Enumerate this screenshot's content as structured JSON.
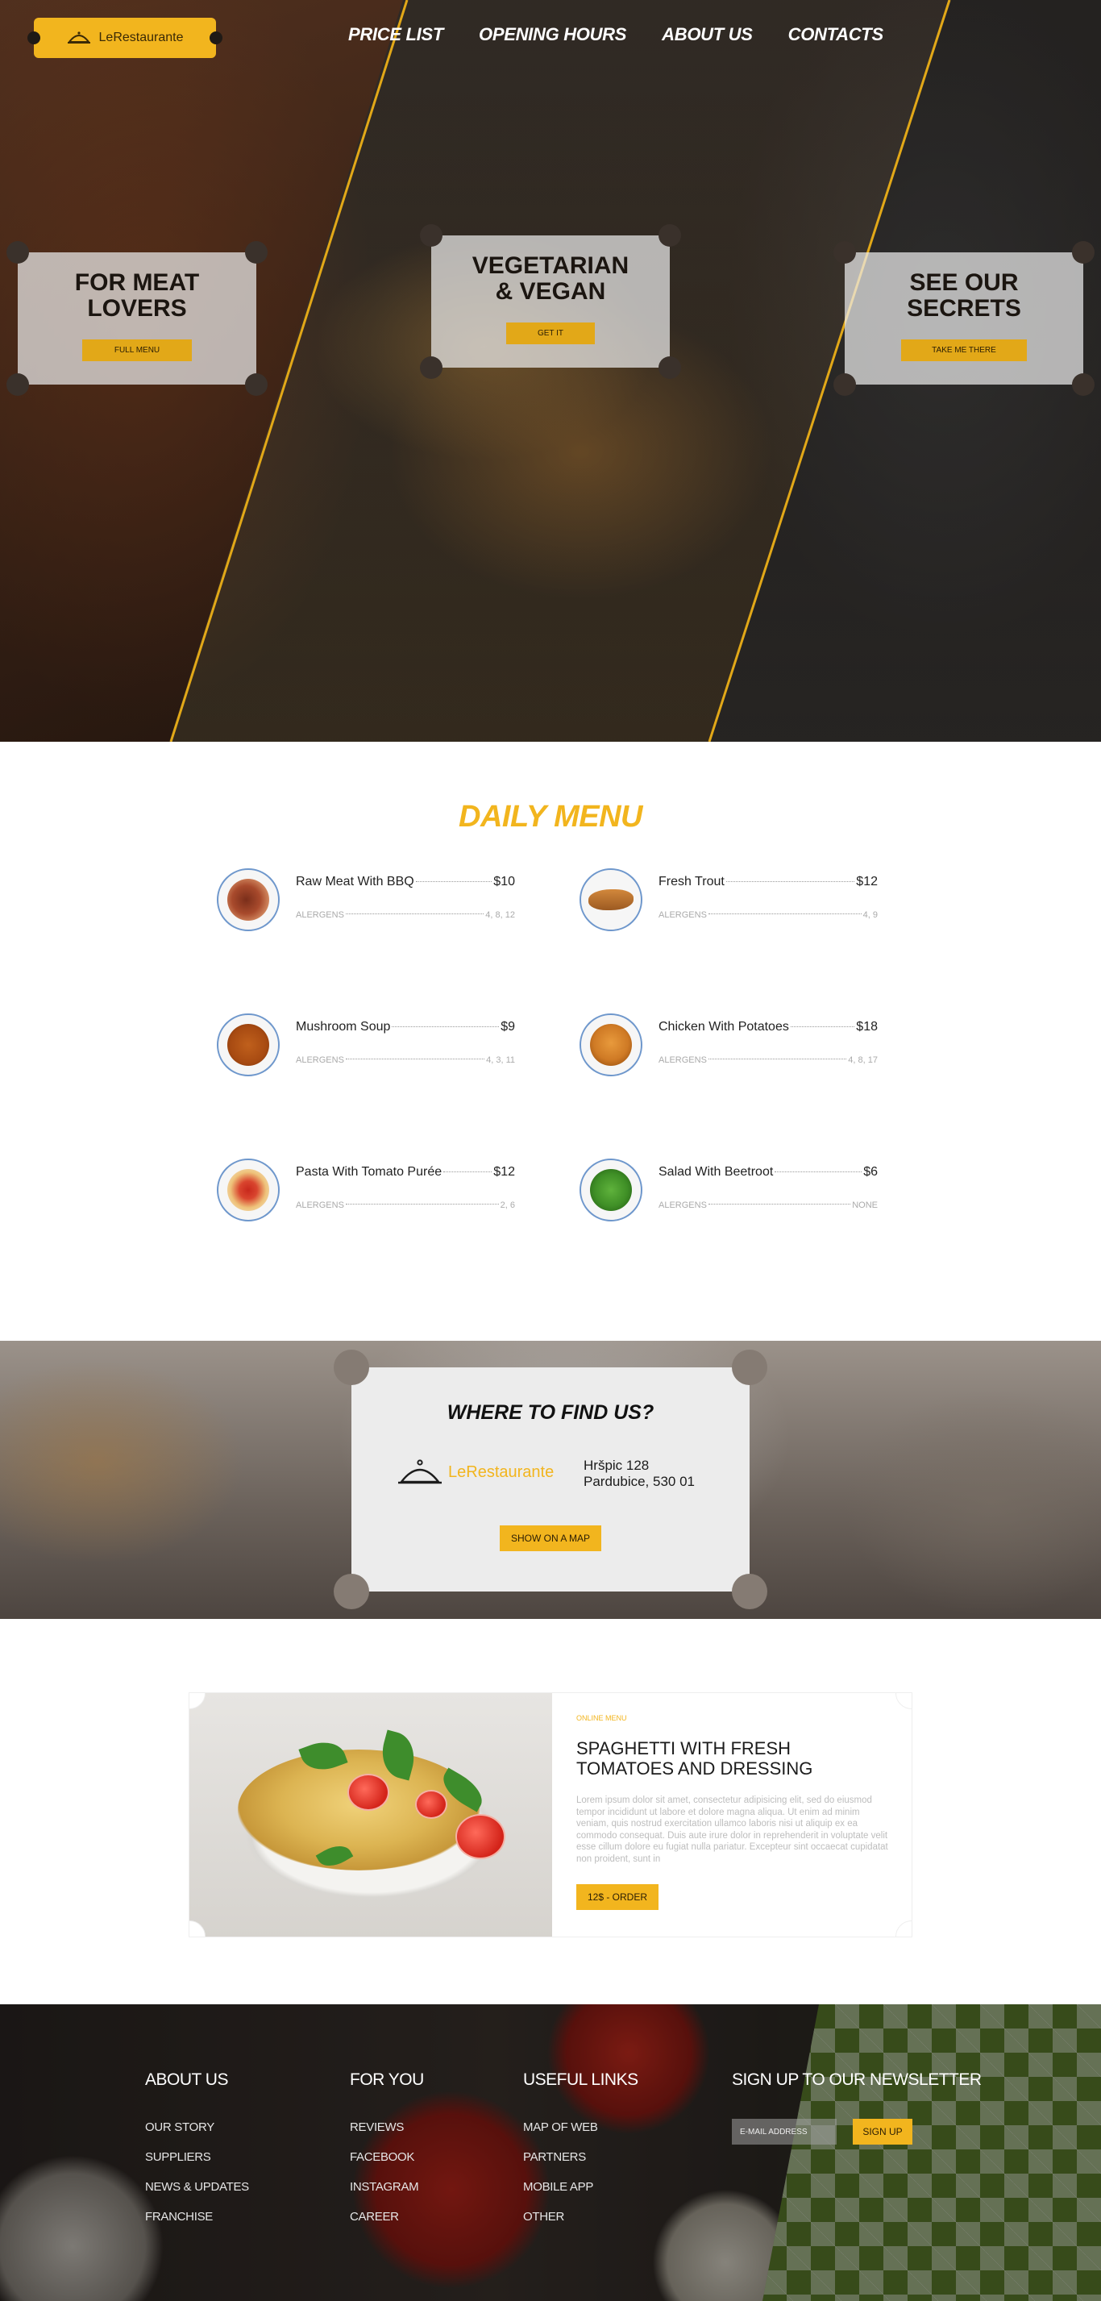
{
  "brand": {
    "name": "LeRestaurante"
  },
  "nav": {
    "items": [
      {
        "label": "Price List"
      },
      {
        "label": "Opening Hours"
      },
      {
        "label": "About Us"
      },
      {
        "label": "Contacts"
      }
    ]
  },
  "hero": {
    "panels": [
      {
        "title": "For Meat Lovers",
        "button": "Full Menu"
      },
      {
        "title": "Vegetarian & Vegan",
        "button": "Get It"
      },
      {
        "title": "See Our Secrets",
        "button": "Take Me There"
      }
    ]
  },
  "daily_menu": {
    "title": "Daily Menu",
    "allergens_label": "Alergens",
    "items": [
      {
        "name": "Raw Meat With BBQ",
        "price": "$10",
        "allergens": "4, 8, 12",
        "icon": "bbq-meat-icon"
      },
      {
        "name": "Fresh Trout",
        "price": "$12",
        "allergens": "4, 9",
        "icon": "fish-icon"
      },
      {
        "name": "Mushroom Soup",
        "price": "$9",
        "allergens": "4, 3, 11",
        "icon": "soup-icon"
      },
      {
        "name": "Chicken With Potatoes",
        "price": "$18",
        "allergens": "4, 8, 17",
        "icon": "chicken-icon"
      },
      {
        "name": "Pasta With Tomato Purée",
        "price": "$12",
        "allergens": "2, 6",
        "icon": "pasta-icon"
      },
      {
        "name": "Salad With Beetroot",
        "price": "$6",
        "allergens": "None",
        "icon": "salad-icon"
      }
    ]
  },
  "location": {
    "title": "Where To Find Us?",
    "brand": "LeRestaurante",
    "address_line1": "Hršpic 128",
    "address_line2": "Pardubice, 530 01",
    "button": "Show On A Map"
  },
  "feature": {
    "kicker": "Online Menu",
    "title": "Spaghetti With Fresh Tomatoes And Dressing",
    "description": "Lorem ipsum dolor sit amet, consectetur adipisicing elit, sed do eiusmod tempor incididunt ut labore et dolore magna aliqua. Ut enim ad minim veniam, quis nostrud exercitation ullamco laboris nisi ut aliquip ex ea commodo consequat. Duis aute irure dolor in reprehenderit in voluptate velit esse cillum dolore eu fugiat nulla pariatur. Excepteur sint occaecat cupidatat non proident, sunt in",
    "button": "12$ - Order"
  },
  "footer": {
    "about": {
      "title": "About Us",
      "links": [
        "Our Story",
        "Suppliers",
        "News & Updates",
        "Franchise"
      ]
    },
    "for_you": {
      "title": "For You",
      "links": [
        "Reviews",
        "Facebook",
        "Instagram",
        "Career"
      ]
    },
    "useful": {
      "title": "Useful Links",
      "links": [
        "Map Of Web",
        "Partners",
        "Mobile App",
        "Other"
      ]
    },
    "newsletter": {
      "title": "Sign Up To Our Newsletter",
      "placeholder": "E-mail Address",
      "button": "Sign Up"
    }
  },
  "colors": {
    "accent": "#f2b51e",
    "plate_border": "#6e97cc"
  }
}
